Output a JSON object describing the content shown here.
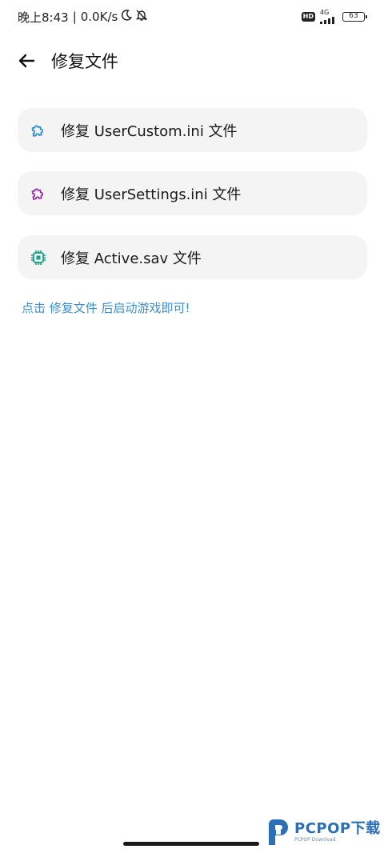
{
  "status_bar": {
    "time": "晚上8:43",
    "separator": "|",
    "speed": "0.0K/s",
    "hd": "HD",
    "network_type": "4G",
    "battery": "63"
  },
  "app_bar": {
    "title": "修复文件"
  },
  "items": [
    {
      "label": "修复 UserCustom.ini 文件",
      "icon": "puzzle-icon",
      "color": "#2f8fcf"
    },
    {
      "label": "修复 UserSettings.ini 文件",
      "icon": "puzzle-icon",
      "color": "#9a2fa8"
    },
    {
      "label": "修复 Active.sav 文件",
      "icon": "chip-icon",
      "color": "#16a085"
    }
  ],
  "hint": "点击 修复文件 后启动游戏即可!",
  "watermark": {
    "main": "PCPOP下载",
    "sub": "PCPOP Download"
  },
  "colors": {
    "accent": "#3a8fd0",
    "card_background": "#f4f4f4"
  }
}
